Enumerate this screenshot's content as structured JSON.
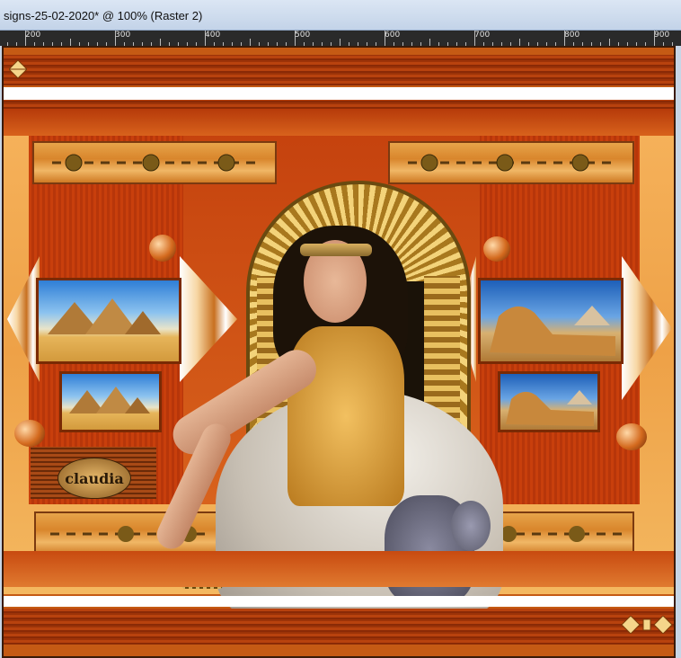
{
  "window": {
    "title": "signs-25-02-2020* @ 100% (Raster 2)"
  },
  "ruler": {
    "labels": [
      "200",
      "300",
      "400",
      "500",
      "600",
      "700",
      "800",
      "900"
    ]
  },
  "canvas": {
    "watermark": "claudia"
  },
  "colors": {
    "frame": "#8a2a06",
    "panel": "#eea147",
    "accent": "#c55a14",
    "gold": "#d9862c"
  }
}
